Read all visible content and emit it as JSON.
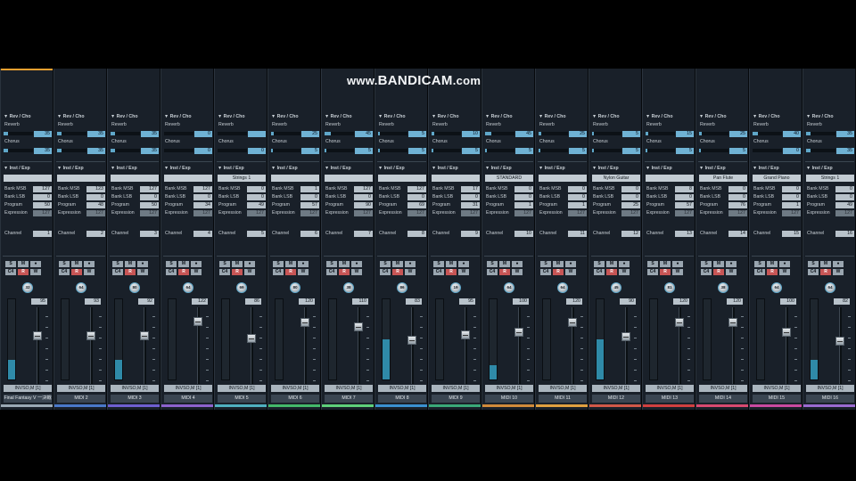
{
  "watermark": {
    "prefix": "www.",
    "brand": "BANDICAM",
    "suffix": ".com"
  },
  "labels": {
    "rev_cho": "▼ Rev / Cho",
    "reverb": "Reverb",
    "chorus": "Chorus",
    "inst_exp": "▼ Inst / Exp",
    "bank_msb": "Bank MSB",
    "bank_lsb": "Bank LSB",
    "program": "Program",
    "expression": "Expression",
    "channel": "Channel",
    "s": "S",
    "m": "M",
    "rec": "●",
    "r": "R",
    "w": "W",
    "rewind": "C4"
  },
  "colors": {
    "accent": "#5fa7c9",
    "selected": "#f0a030"
  },
  "strips": [
    {
      "name": "Final Fantasy V 一決戦",
      "reverb": "35",
      "reverb_lvl": 0.15,
      "chorus": "35",
      "chorus_lvl": 0.15,
      "inst": "",
      "msb": "127",
      "lsb": "0",
      "prog": "50",
      "expr": "127",
      "ch": "1",
      "pan": "32",
      "vol": "95",
      "meter": 0.25,
      "fader": 0.64,
      "insert": "INVSO,M [1]",
      "color": "#9aa8b4"
    },
    {
      "name": "MIDI 2",
      "reverb": "35",
      "reverb_lvl": 0.15,
      "chorus": "35",
      "chorus_lvl": 0.15,
      "inst": "",
      "msb": "123",
      "lsb": "0",
      "prog": "48",
      "expr": "127",
      "ch": "2",
      "pan": "64",
      "vol": "93",
      "meter": 0,
      "fader": 0.64,
      "insert": "INVSO,M [1]",
      "color": "#4a78c8"
    },
    {
      "name": "MIDI 3",
      "reverb": "35",
      "reverb_lvl": 0.15,
      "chorus": "35",
      "chorus_lvl": 0.15,
      "inst": "",
      "msb": "127",
      "lsb": "0",
      "prog": "50",
      "expr": "127",
      "ch": "3",
      "pan": "80",
      "vol": "92",
      "meter": 0.25,
      "fader": 0.64,
      "insert": "INVSO,M [1]",
      "color": "#6e5fd0"
    },
    {
      "name": "MIDI 4",
      "reverb": "0",
      "reverb_lvl": 0,
      "chorus": "0",
      "chorus_lvl": 0,
      "inst": "",
      "msb": "127",
      "lsb": "0",
      "prog": "34",
      "expr": "127",
      "ch": "4",
      "pan": "64",
      "vol": "122",
      "meter": 0,
      "fader": 0.85,
      "insert": "INVSO,M [1]",
      "color": "#8c62cc"
    },
    {
      "name": "MIDI 5",
      "reverb": "",
      "reverb_lvl": 0,
      "chorus": "0",
      "chorus_lvl": 0,
      "inst": "Strings 1",
      "msb": "0",
      "lsb": "0",
      "prog": "49",
      "expr": "127",
      "ch": "5",
      "pan": "69",
      "vol": "86",
      "meter": 0,
      "fader": 0.6,
      "insert": "INVSO,M [1]",
      "color": "#4fb0c0"
    },
    {
      "name": "MIDI 6",
      "reverb": "25",
      "reverb_lvl": 0.1,
      "chorus": "5",
      "chorus_lvl": 0.05,
      "inst": "",
      "msb": "1",
      "lsb": "0",
      "prog": "57",
      "expr": "127",
      "ch": "6",
      "pan": "80",
      "vol": "120",
      "meter": 0,
      "fader": 0.84,
      "insert": "INVSO,M [1]",
      "color": "#44b86a"
    },
    {
      "name": "MIDI 7",
      "reverb": "45",
      "reverb_lvl": 0.2,
      "chorus": "5",
      "chorus_lvl": 0.05,
      "inst": "",
      "msb": "127",
      "lsb": "0",
      "prog": "90",
      "expr": "127",
      "ch": "7",
      "pan": "38",
      "vol": "110",
      "meter": 0,
      "fader": 0.78,
      "insert": "INVSO,M [1]",
      "color": "#5ecf7a"
    },
    {
      "name": "MIDI 8",
      "reverb": "5",
      "reverb_lvl": 0.05,
      "chorus": "5",
      "chorus_lvl": 0.05,
      "inst": "",
      "msb": "127",
      "lsb": "0",
      "prog": "69",
      "expr": "127",
      "ch": "8",
      "pan": "86",
      "vol": "83",
      "meter": 0.5,
      "fader": 0.58,
      "insert": "INVSO,M [1]",
      "color": "#3a90d0"
    },
    {
      "name": "MIDI 9",
      "reverb": "10",
      "reverb_lvl": 0.08,
      "chorus": "5",
      "chorus_lvl": 0.05,
      "inst": "",
      "msb": "17",
      "lsb": "0",
      "prog": "31",
      "expr": "127",
      "ch": "9",
      "pan": "19",
      "vol": "95",
      "meter": 0,
      "fader": 0.66,
      "insert": "INVSO,M [1]",
      "color": "#3aa878"
    },
    {
      "name": "MIDI 10",
      "reverb": "45",
      "reverb_lvl": 0.2,
      "chorus": "5",
      "chorus_lvl": 0.05,
      "inst": "STANDARD",
      "msb": "0",
      "lsb": "0",
      "prog": "1",
      "expr": "127",
      "ch": "10",
      "pan": "64",
      "vol": "100",
      "meter": 0.18,
      "fader": 0.7,
      "insert": "INVSO,M [1]",
      "color": "#d08a3a"
    },
    {
      "name": "MIDI 11",
      "reverb": "25",
      "reverb_lvl": 0.1,
      "chorus": "5",
      "chorus_lvl": 0.05,
      "inst": "",
      "msb": "0",
      "lsb": "0",
      "prog": "1",
      "expr": "127",
      "ch": "11",
      "pan": "64",
      "vol": "120",
      "meter": 0,
      "fader": 0.84,
      "insert": "INVSO,M [1]",
      "color": "#e0a040"
    },
    {
      "name": "MIDI 12",
      "reverb": "5",
      "reverb_lvl": 0.05,
      "chorus": "5",
      "chorus_lvl": 0.05,
      "inst": "Nylon Guitar",
      "msb": "0",
      "lsb": "0",
      "prog": "25",
      "expr": "127",
      "ch": "12",
      "pan": "45",
      "vol": "90",
      "meter": 0.5,
      "fader": 0.63,
      "insert": "INVSO,M [1]",
      "color": "#d05848"
    },
    {
      "name": "MIDI 13",
      "reverb": "15",
      "reverb_lvl": 0.08,
      "chorus": "5",
      "chorus_lvl": 0.05,
      "inst": "",
      "msb": "8",
      "lsb": "0",
      "prog": "57",
      "expr": "127",
      "ch": "13",
      "pan": "81",
      "vol": "120",
      "meter": 0,
      "fader": 0.84,
      "insert": "INVSO,M [1]",
      "color": "#d04040"
    },
    {
      "name": "MIDI 14",
      "reverb": "25",
      "reverb_lvl": 0.1,
      "chorus": "5",
      "chorus_lvl": 0.05,
      "inst": "Pan Flute",
      "msb": "0",
      "lsb": "0",
      "prog": "76",
      "expr": "127",
      "ch": "14",
      "pan": "38",
      "vol": "120",
      "meter": 0,
      "fader": 0.84,
      "insert": "INVSO,M [1]",
      "color": "#d84a70"
    },
    {
      "name": "MIDI 15",
      "reverb": "40",
      "reverb_lvl": 0.18,
      "chorus": "0",
      "chorus_lvl": 0,
      "inst": "Grand Piano",
      "msb": "0",
      "lsb": "0",
      "prog": "1",
      "expr": "127",
      "ch": "15",
      "pan": "64",
      "vol": "100",
      "meter": 0,
      "fader": 0.7,
      "insert": "INVSO,M [1]",
      "color": "#c84aa0"
    },
    {
      "name": "MIDI 16",
      "reverb": "35",
      "reverb_lvl": 0.15,
      "chorus": "35",
      "chorus_lvl": 0.15,
      "inst": "Strings 1",
      "msb": "0",
      "lsb": "0",
      "prog": "49",
      "expr": "127",
      "ch": "16",
      "pan": "64",
      "vol": "82",
      "meter": 0.25,
      "fader": 0.57,
      "insert": "INVSO,M [1]",
      "color": "#9a6ad0"
    }
  ]
}
